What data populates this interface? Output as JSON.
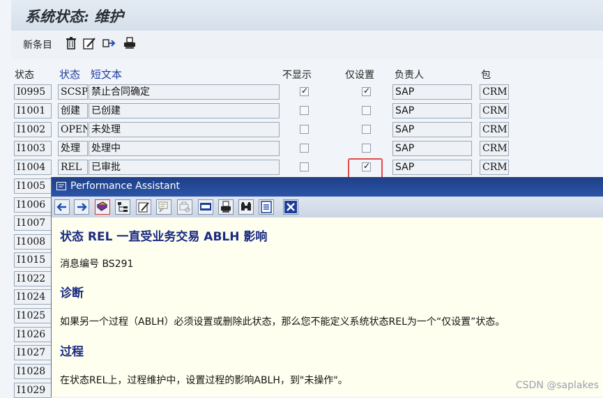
{
  "window": {
    "title": "系统状态: 维护"
  },
  "toolbar": {
    "new_entries": "新条目"
  },
  "table": {
    "headers": {
      "status": "状态",
      "status2": "状态",
      "short_text": "短文本",
      "no_display": "不显示",
      "only_set": "仅设置",
      "owner": "负责人",
      "package": "包"
    },
    "rows": [
      {
        "status": "I0995",
        "code": "SCSP",
        "text": "禁止合同确定",
        "no_display": true,
        "only_set": true,
        "owner": "SAP",
        "pkg": "CRM..."
      },
      {
        "status": "I1001",
        "code": "创建",
        "text": "已创建",
        "no_display": false,
        "only_set": false,
        "owner": "SAP",
        "pkg": "CRM..."
      },
      {
        "status": "I1002",
        "code": "OPEN",
        "text": "未处理",
        "no_display": false,
        "only_set": false,
        "owner": "SAP",
        "pkg": "CRM..."
      },
      {
        "status": "I1003",
        "code": "处理",
        "text": "处理中",
        "no_display": false,
        "only_set": false,
        "owner": "SAP",
        "pkg": "CRM..."
      },
      {
        "status": "I1004",
        "code": "REL",
        "text": "已审批",
        "no_display": false,
        "only_set": true,
        "owner": "SAP",
        "pkg": "CRM..."
      }
    ],
    "more_status": [
      "I1005",
      "I1006",
      "I1007",
      "I1008",
      "I1015",
      "I1022",
      "I1024",
      "I1025",
      "I1026",
      "I1027",
      "I1028",
      "I1029"
    ]
  },
  "popup": {
    "title": "Performance Assistant",
    "heading": "状态  REL 一直受业务交易 ABLH 影响",
    "message_no": "消息编号 BS291",
    "diag_title": "诊断",
    "diag_text": "如果另一个过程（ABLH）必须设置或删除此状态，那么您不能定义系统状态REL为一个“仅设置”状态。",
    "proc_title": "过程",
    "proc_text": "在状态REL上，过程维护中，设置过程的影响ABLH，到\"未操作\"。"
  },
  "watermark": "CSDN @saplakes"
}
